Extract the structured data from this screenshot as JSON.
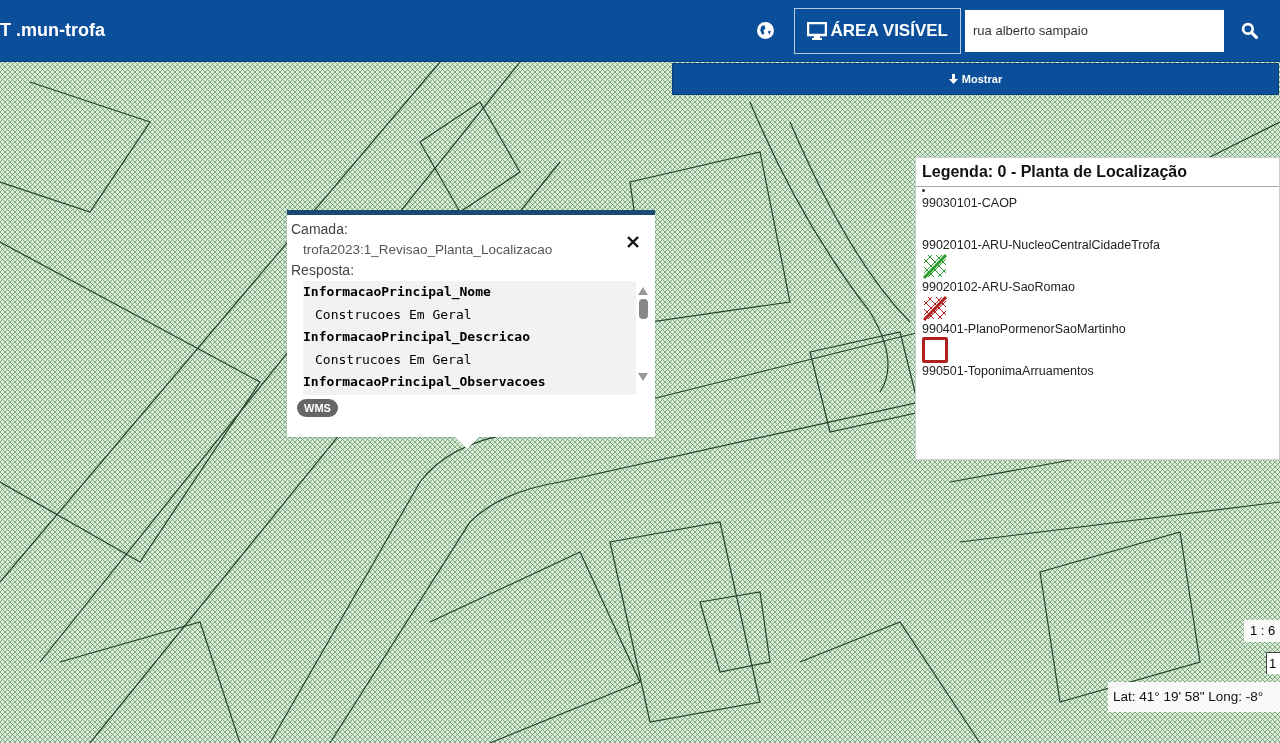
{
  "header": {
    "title": "T .mun-trofa",
    "view_button": "ÁREA VISÍVEL",
    "search": {
      "value": "rua alberto sampaio"
    }
  },
  "toggle_bar": {
    "label": "Mostrar"
  },
  "popup": {
    "layer_label": "Camada:",
    "layer": "trofa2023:1_Revisao_Planta_Localizacao",
    "response_label": "Resposta:",
    "fields": [
      {
        "kind": "key",
        "text": "InformacaoPrincipal_Nome"
      },
      {
        "kind": "value",
        "text": "Construcoes Em Geral"
      },
      {
        "kind": "key",
        "text": "InformacaoPrincipal_Descricao"
      },
      {
        "kind": "value",
        "text": "Construcoes Em Geral"
      },
      {
        "kind": "key",
        "text": "InformacaoPrincipal_Observacoes"
      }
    ],
    "badge": "WMS"
  },
  "legend": {
    "title": "Legenda: 0 - Planta de Localização",
    "items": [
      {
        "kind": "dot",
        "label": "99030101-CAOP"
      },
      {
        "label": "99020101-ARU-NucleoCentralCidadeTrofa"
      },
      {
        "kind": "hatch",
        "color": "#2e9e2e",
        "label": "99020102-ARU-SaoRomao"
      },
      {
        "kind": "hatch",
        "color": "#b02020",
        "label": "990401-PlanoPormenorSaoMartinho"
      },
      {
        "kind": "square",
        "color": "#b02020",
        "label": "990501-ToponimaArruamentos"
      }
    ]
  },
  "scale": {
    "text": "1 : 6",
    "text_2": "1"
  },
  "coordinates": "Lat: 41° 19' 58\" Long: -8°"
}
